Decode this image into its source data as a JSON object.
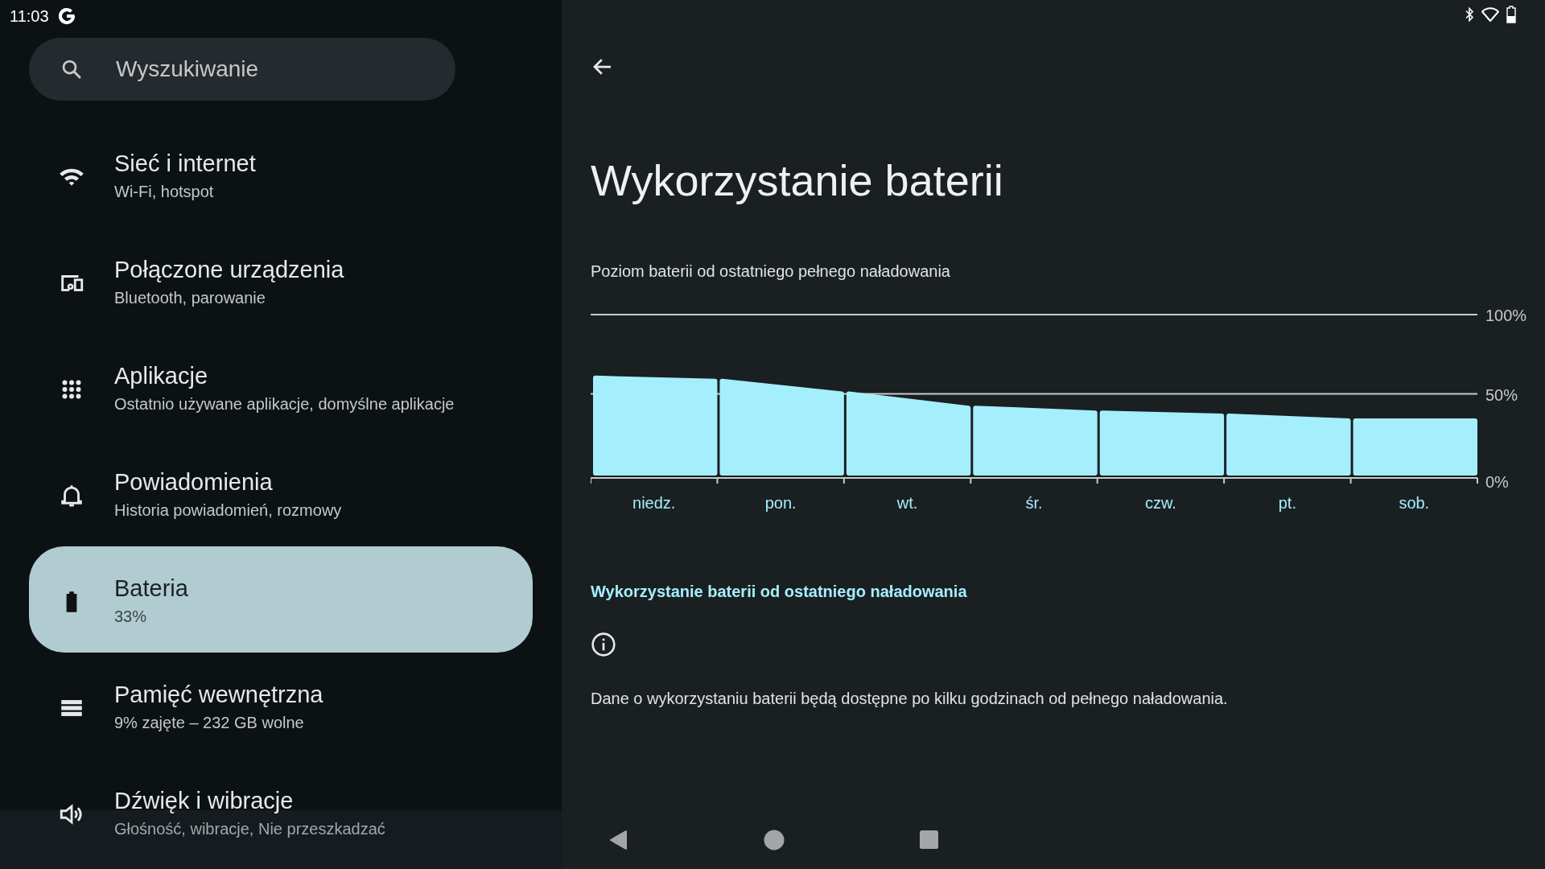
{
  "status_bar": {
    "time": "11:03"
  },
  "search": {
    "placeholder": "Wyszukiwanie"
  },
  "sidebar": {
    "items": [
      {
        "title": "Sieć i internet",
        "subtitle": "Wi-Fi, hotspot",
        "kind": "wifi",
        "selected": false
      },
      {
        "title": "Połączone urządzenia",
        "subtitle": "Bluetooth, parowanie",
        "kind": "devices",
        "selected": false
      },
      {
        "title": "Aplikacje",
        "subtitle": "Ostatnio używane aplikacje, domyślne aplikacje",
        "kind": "apps",
        "selected": false
      },
      {
        "title": "Powiadomienia",
        "subtitle": "Historia powiadomień, rozmowy",
        "kind": "bell",
        "selected": false
      },
      {
        "title": "Bateria",
        "subtitle": "33%",
        "kind": "battery",
        "selected": true
      },
      {
        "title": "Pamięć wewnętrzna",
        "subtitle": "9% zajęte – 232 GB wolne",
        "kind": "storage",
        "selected": false
      },
      {
        "title": "Dźwięk i wibracje",
        "subtitle": "Głośność, wibracje, Nie przeszkadzać",
        "kind": "sound",
        "selected": false
      }
    ]
  },
  "page": {
    "title": "Wykorzystanie baterii",
    "chart_caption": "Poziom baterii od ostatniego pełnego naładowania",
    "chart_data": {
      "type": "bar",
      "categories": [
        "niedz.",
        "pon.",
        "wt.",
        "śr.",
        "czw.",
        "pt.",
        "sob."
      ],
      "ylim": [
        0,
        100
      ],
      "yticks": [
        {
          "value": 0,
          "label": "0%"
        },
        {
          "value": 50,
          "label": "50%"
        },
        {
          "value": 100,
          "label": "100%"
        }
      ],
      "series": [
        {
          "color": "#a5effd",
          "values": [
            60,
            58,
            50,
            41,
            38,
            36,
            33
          ]
        }
      ]
    },
    "section_title": "Wykorzystanie baterii od ostatniego naładowania",
    "info_text": "Dane o wykorzystaniu baterii będą dostępne po kilku godzinach od pełnego naładowania."
  }
}
